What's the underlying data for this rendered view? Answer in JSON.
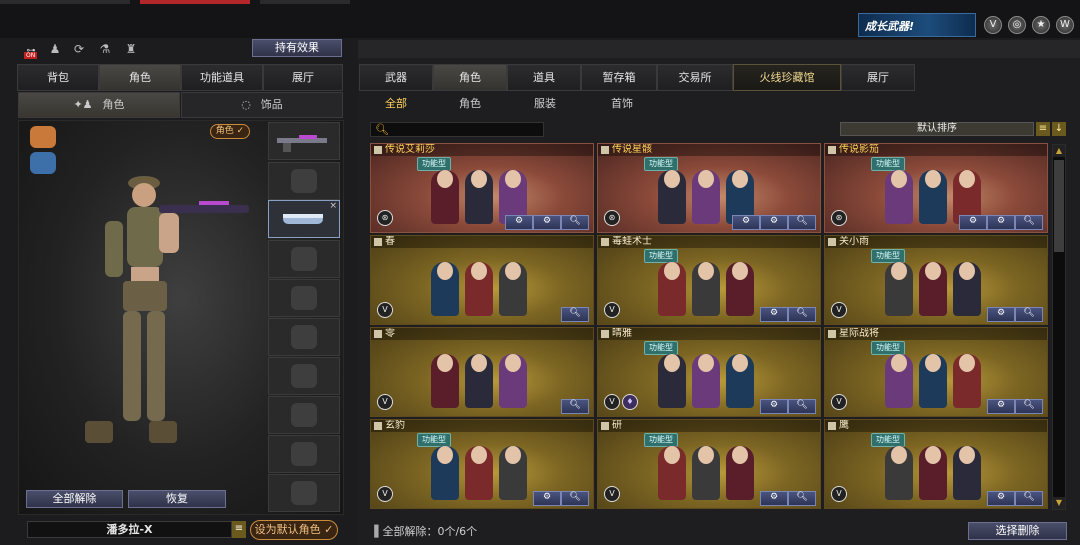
{
  "header": {
    "growth_banner": "成长武器!",
    "top_icons": [
      "shield-v-icon",
      "target-icon",
      "star-badge-icon",
      "wing-v-icon"
    ]
  },
  "left": {
    "toolbar_icons": [
      {
        "name": "on-toggle-icon",
        "label": "ON"
      },
      {
        "name": "team-icon",
        "label": ""
      },
      {
        "name": "refresh-icon",
        "label": ""
      },
      {
        "name": "lab-icon",
        "label": ""
      },
      {
        "name": "bag-icon",
        "label": ""
      }
    ],
    "held_effects": "持有效果",
    "tabs": [
      "背包",
      "角色",
      "功能道具",
      "展厅"
    ],
    "active_tab": 1,
    "subtabs": [
      "角色",
      "饰品"
    ],
    "role_badge": "角色 ✓",
    "buttons": {
      "unequip_all": "全部解除",
      "restore": "恢复"
    },
    "character_name": "潘多拉-X",
    "set_default": "设为默认角色 ✓"
  },
  "right": {
    "tabs": [
      "武器",
      "角色",
      "道具",
      "暂存箱",
      "交易所",
      "火线珍藏馆",
      "展厅"
    ],
    "active_tab": 1,
    "subtabs": [
      "全部",
      "角色",
      "服装",
      "首饰"
    ],
    "active_subtab": 0,
    "sort_label": "默认排序",
    "cards": [
      {
        "title": "传说艾莉莎",
        "badge": "功能型",
        "style": "red",
        "v_icon": "ribbon",
        "buttons": 3
      },
      {
        "title": "传说星骸",
        "badge": "功能型",
        "style": "red",
        "v_icon": "ribbon",
        "buttons": 3
      },
      {
        "title": "传说影笳",
        "badge": "功能型",
        "style": "red",
        "v_icon": "ribbon",
        "buttons": 3
      },
      {
        "title": "春",
        "badge": "",
        "style": "gold",
        "v_icon": "V",
        "buttons": 1
      },
      {
        "title": "毒蛙术士",
        "badge": "功能型",
        "style": "gold",
        "v_icon": "V",
        "buttons": 2
      },
      {
        "title": "关小雨",
        "badge": "功能型",
        "style": "gold",
        "v_icon": "V",
        "buttons": 2
      },
      {
        "title": "零",
        "badge": "",
        "style": "gold",
        "v_icon": "V",
        "buttons": 1
      },
      {
        "title": "晴雅",
        "badge": "功能型",
        "style": "gold",
        "v_icon": "V",
        "buttons": 2,
        "extra_icon": true
      },
      {
        "title": "星际战将",
        "badge": "功能型",
        "style": "gold",
        "v_icon": "V",
        "buttons": 2
      },
      {
        "title": "玄豹",
        "badge": "功能型",
        "style": "gold",
        "v_icon": "V",
        "buttons": 2
      },
      {
        "title": "研",
        "badge": "功能型",
        "style": "gold",
        "v_icon": "V",
        "buttons": 2
      },
      {
        "title": "鹰",
        "badge": "功能型",
        "style": "gold",
        "v_icon": "V",
        "buttons": 2
      }
    ],
    "bottom_status": "全部解除：0个/6个",
    "select_delete": "选择删除"
  }
}
